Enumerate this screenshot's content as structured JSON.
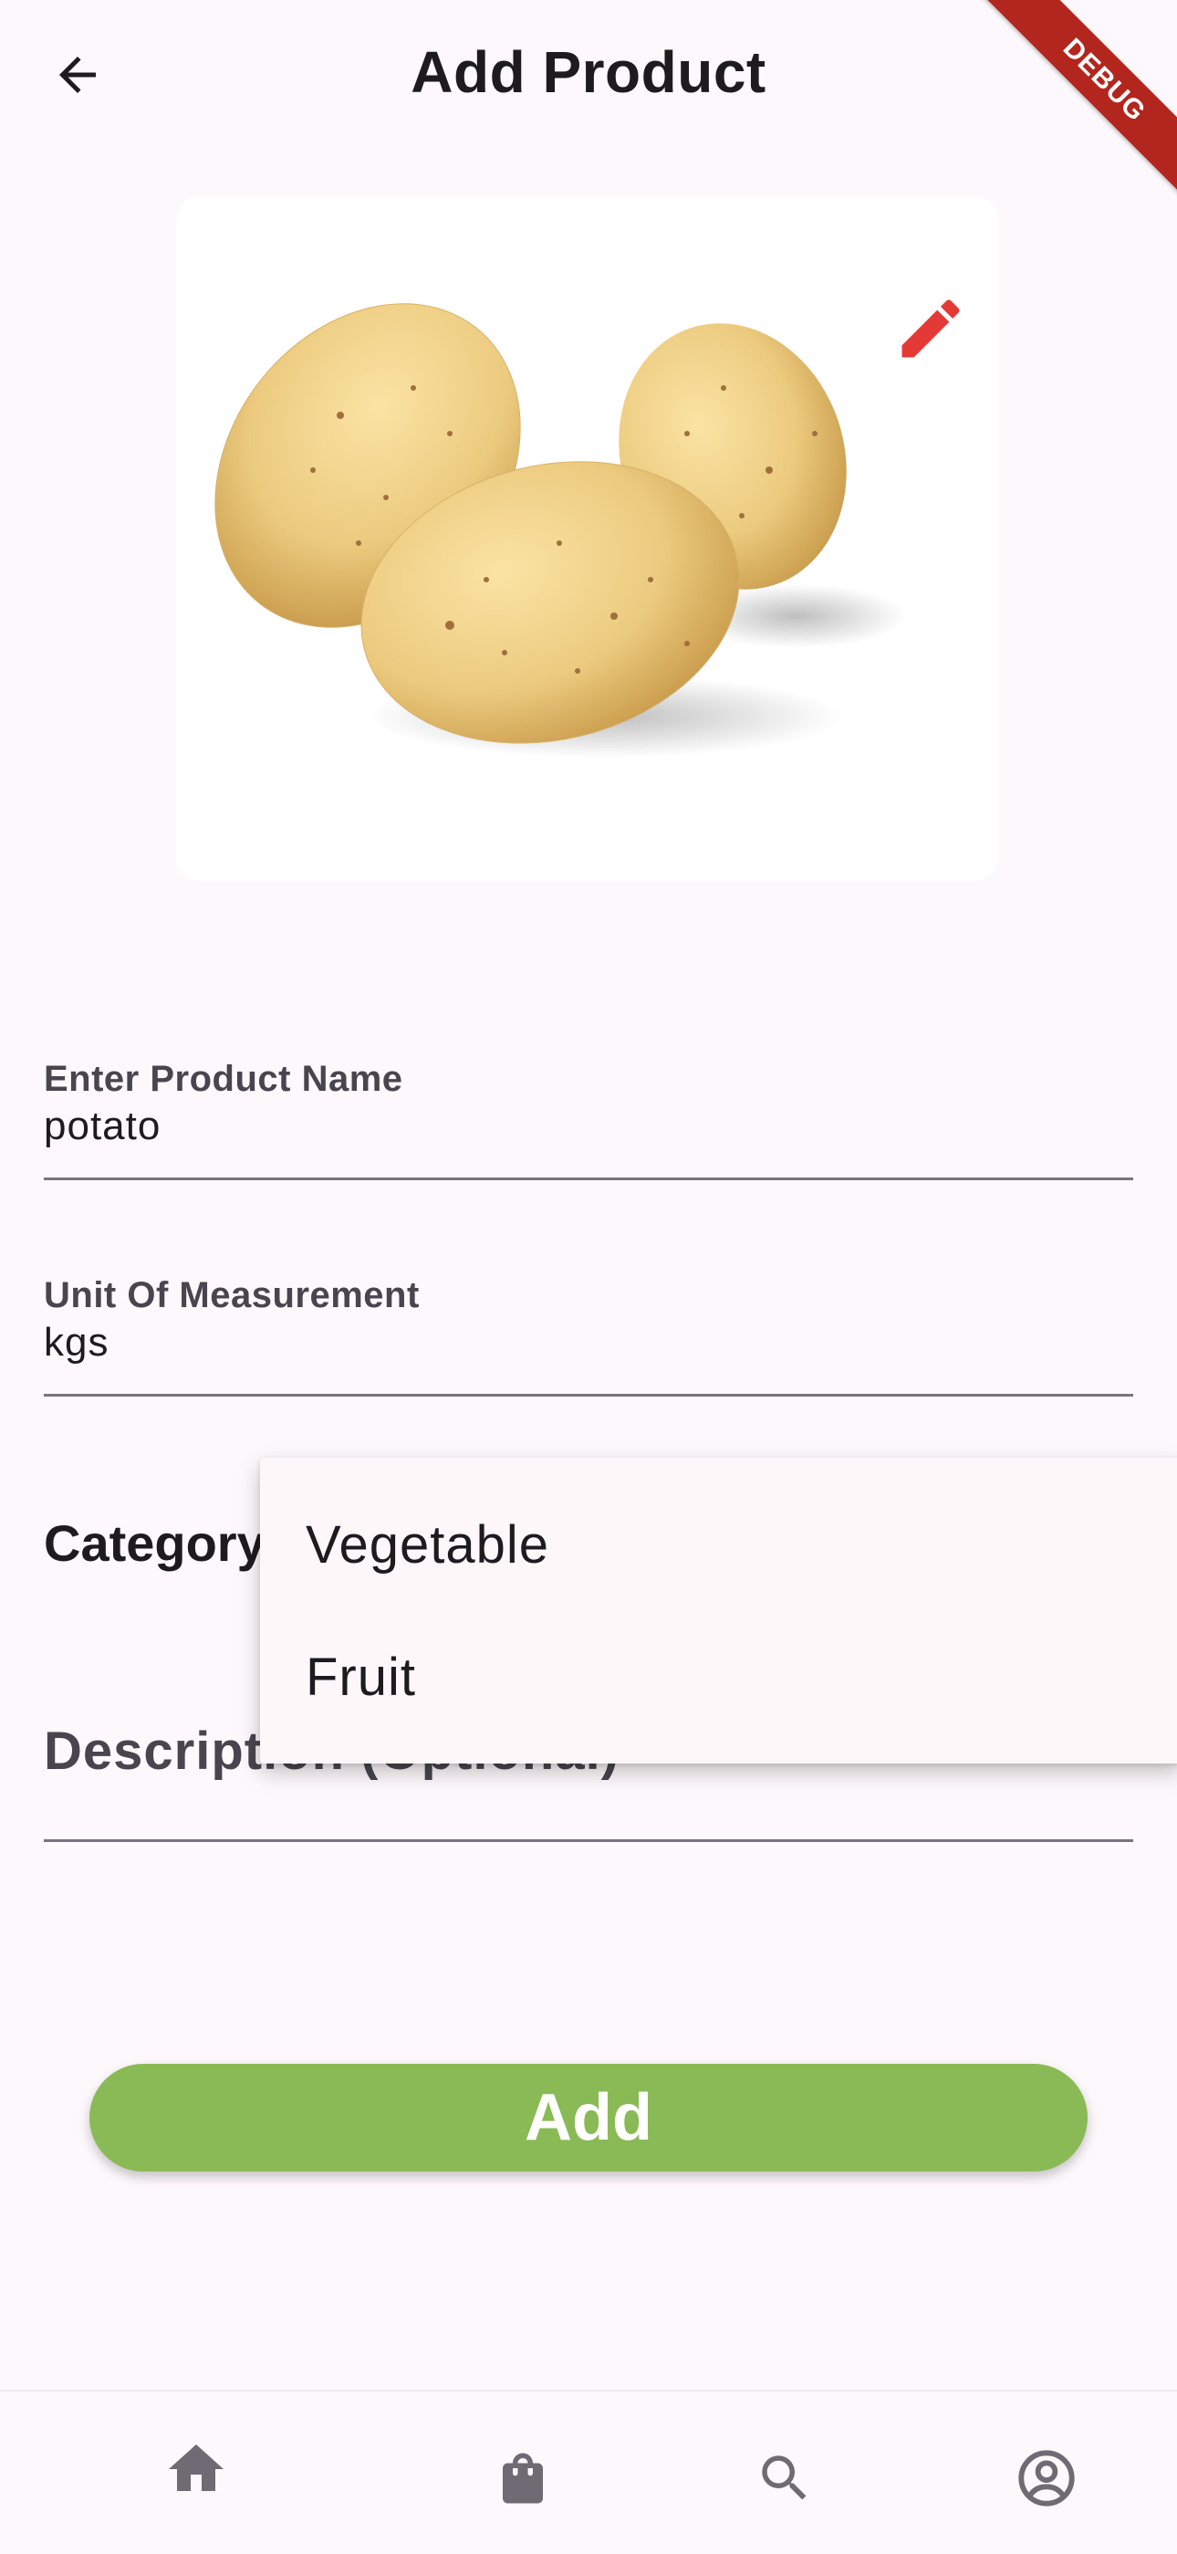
{
  "app_bar": {
    "title": "Add Product",
    "back_icon": "arrow-back-icon"
  },
  "debug_banner": "DEBUG",
  "product_image": {
    "edit_icon": "pencil-icon",
    "edit_color": "#e53935"
  },
  "form": {
    "product_name": {
      "label": "Enter Product Name",
      "value": "potato"
    },
    "unit": {
      "label": "Unit Of Measurement",
      "value": "kgs"
    },
    "category": {
      "label": "Category"
    },
    "description": {
      "placeholder": "Description (Optional)"
    }
  },
  "dropdown": {
    "options": [
      "Vegetable",
      "Fruit"
    ]
  },
  "add_button": {
    "label": "Add",
    "color": "#8aba55"
  },
  "bottom_nav": {
    "items": [
      "home-icon",
      "shopping-bag-icon",
      "search-icon",
      "account-circle-icon"
    ]
  },
  "colors": {
    "background": "#fdf8fb",
    "primary_text": "#1d1b20",
    "secondary_text": "#49454f",
    "debug_red": "#b3261e"
  }
}
